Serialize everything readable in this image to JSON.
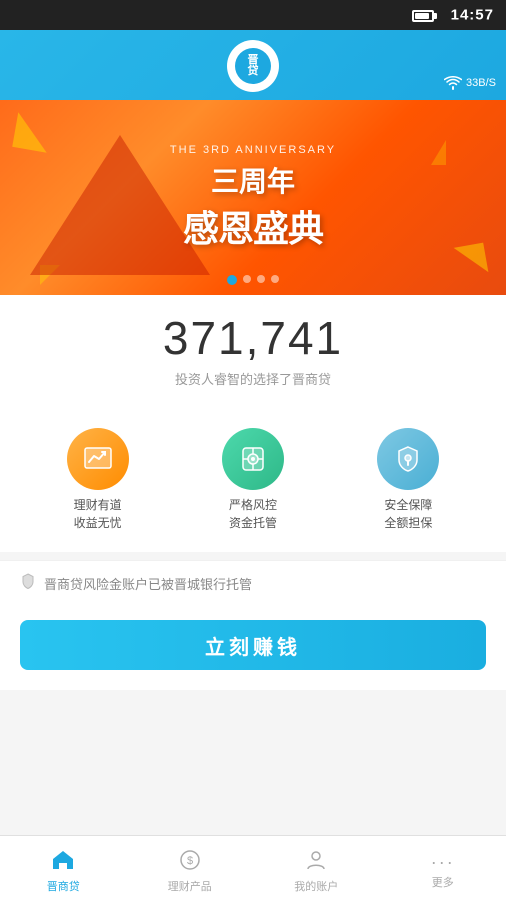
{
  "statusBar": {
    "time": "14:57",
    "network": "33B/S"
  },
  "header": {
    "logoText": "晋商贷",
    "logoShort": "晋\n贷"
  },
  "banner": {
    "subText": "THE 3RD ANNIVERSARY",
    "titleLine1": "三周年",
    "titleLine2": "感恩盛典",
    "dots": [
      true,
      false,
      false,
      false
    ]
  },
  "stats": {
    "number": "371,741",
    "subtitle": "投资人睿智的选择了晋商贷"
  },
  "features": [
    {
      "icon": "📈",
      "line1": "理财有道",
      "line2": "收益无忧",
      "colorClass": "feature-icon-orange"
    },
    {
      "icon": "🔒",
      "line1": "严格风控",
      "line2": "资金托管",
      "colorClass": "feature-icon-green"
    },
    {
      "icon": "🛡",
      "line1": "安全保障",
      "line2": "全额担保",
      "colorClass": "feature-icon-blue"
    }
  ],
  "notice": {
    "icon": "🛡",
    "text": "晋商贷风险金账户已被晋城银行托管"
  },
  "cta": {
    "buttonLabel": "立刻赚钱"
  },
  "bottomNav": [
    {
      "id": "home",
      "icon": "🏠",
      "label": "晋商贷",
      "active": true
    },
    {
      "id": "products",
      "icon": "💲",
      "label": "理财产品",
      "active": false
    },
    {
      "id": "account",
      "icon": "👤",
      "label": "我的账户",
      "active": false
    },
    {
      "id": "more",
      "icon": "···",
      "label": "更多",
      "active": false
    }
  ]
}
